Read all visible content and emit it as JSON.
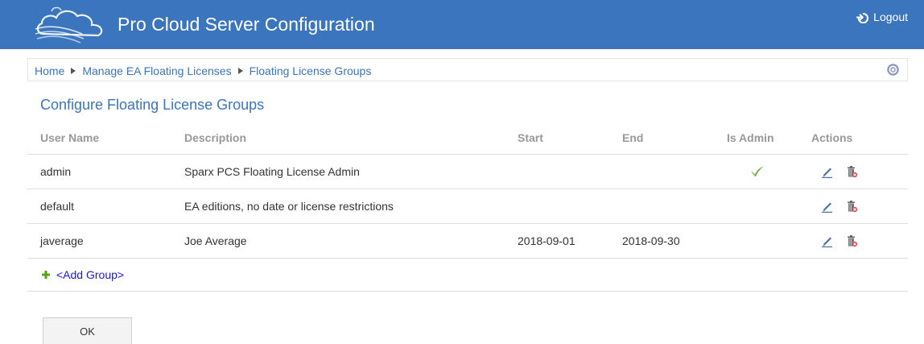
{
  "header": {
    "title": "Pro Cloud Server Configuration",
    "logout_label": "Logout",
    "brand_color": "#3a75bd"
  },
  "breadcrumb": {
    "items": [
      "Home",
      "Manage EA Floating Licenses",
      "Floating License Groups"
    ]
  },
  "page": {
    "title": "Configure Floating License Groups"
  },
  "table": {
    "columns": {
      "user": "User Name",
      "description": "Description",
      "start": "Start",
      "end": "End",
      "is_admin": "Is Admin",
      "actions": "Actions"
    },
    "rows": [
      {
        "user": "admin",
        "description": "Sparx PCS Floating License Admin",
        "start": "",
        "end": "",
        "is_admin": true
      },
      {
        "user": "default",
        "description": "EA editions, no date or license restrictions",
        "start": "",
        "end": "",
        "is_admin": false
      },
      {
        "user": "javerage",
        "description": "Joe Average",
        "start": "2018-09-01",
        "end": "2018-09-30",
        "is_admin": false
      }
    ]
  },
  "add_group_label": "<Add Group>",
  "ok_label": "OK",
  "icons": {
    "logo": "cloud-logo-icon",
    "logout": "logout-icon",
    "help": "help-icon",
    "check": "checkmark-icon",
    "edit": "pencil-icon",
    "delete": "trash-icon",
    "add": "plus-icon"
  },
  "colors": {
    "link": "#3a75bd",
    "check": "#5aa51c",
    "add_link": "#1a1adb",
    "delete_accent": "#d9534f"
  }
}
